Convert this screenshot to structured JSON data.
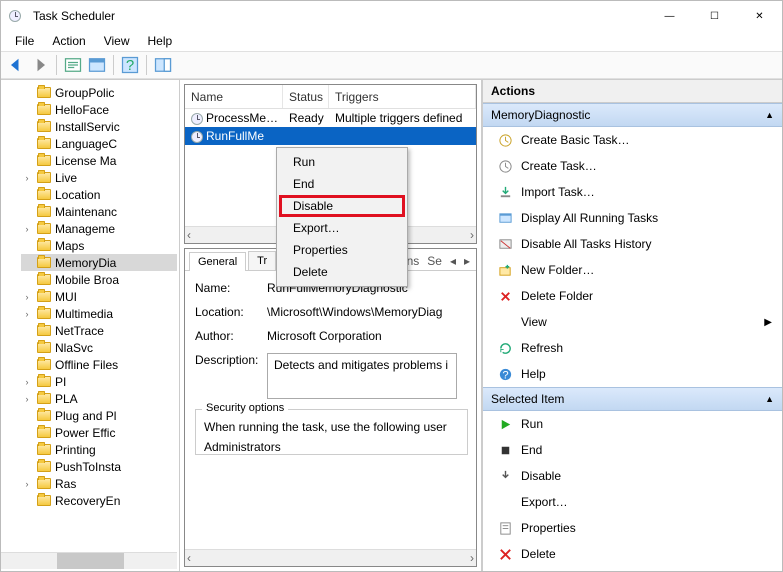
{
  "title": "Task Scheduler",
  "menus": [
    "File",
    "Action",
    "View",
    "Help"
  ],
  "tree": [
    {
      "label": "GroupPolic",
      "twisty": ""
    },
    {
      "label": "HelloFace",
      "twisty": ""
    },
    {
      "label": "InstallServic",
      "twisty": ""
    },
    {
      "label": "LanguageC",
      "twisty": ""
    },
    {
      "label": "License Ma",
      "twisty": ""
    },
    {
      "label": "Live",
      "twisty": "›"
    },
    {
      "label": "Location",
      "twisty": ""
    },
    {
      "label": "Maintenanc",
      "twisty": ""
    },
    {
      "label": "Manageme",
      "twisty": "›"
    },
    {
      "label": "Maps",
      "twisty": ""
    },
    {
      "label": "MemoryDia",
      "twisty": "",
      "selected": true
    },
    {
      "label": "Mobile Broa",
      "twisty": ""
    },
    {
      "label": "MUI",
      "twisty": "›"
    },
    {
      "label": "Multimedia",
      "twisty": "›"
    },
    {
      "label": "NetTrace",
      "twisty": ""
    },
    {
      "label": "NlaSvc",
      "twisty": ""
    },
    {
      "label": "Offline Files",
      "twisty": ""
    },
    {
      "label": "PI",
      "twisty": "›"
    },
    {
      "label": "PLA",
      "twisty": "›"
    },
    {
      "label": "Plug and Pl",
      "twisty": ""
    },
    {
      "label": "Power Effic",
      "twisty": ""
    },
    {
      "label": "Printing",
      "twisty": ""
    },
    {
      "label": "PushToInsta",
      "twisty": ""
    },
    {
      "label": "Ras",
      "twisty": "›"
    },
    {
      "label": "RecoveryEn",
      "twisty": ""
    }
  ],
  "task_columns": {
    "name": "Name",
    "status": "Status",
    "triggers": "Triggers"
  },
  "tasks": [
    {
      "name": "ProcessMe…",
      "status": "Ready",
      "triggers": "Multiple triggers defined"
    },
    {
      "name": "RunFullMe",
      "status": "",
      "triggers": "",
      "selected": true
    }
  ],
  "context_menu": [
    "Run",
    "End",
    "Disable",
    "Export…",
    "Properties",
    "Delete"
  ],
  "context_highlight_index": 2,
  "tabs": {
    "items": [
      "General",
      "Tr"
    ],
    "right": [
      "ns",
      "Se"
    ],
    "active": 0
  },
  "details": {
    "name_label": "Name:",
    "name_value": "RunFullMemoryDiagnostic",
    "location_label": "Location:",
    "location_value": "\\Microsoft\\Windows\\MemoryDiag",
    "author_label": "Author:",
    "author_value": "Microsoft Corporation",
    "description_label": "Description:",
    "description_value": "Detects and mitigates problems i",
    "security_legend": "Security options",
    "security_line1": "When running the task, use the following user",
    "security_line2": "Administrators"
  },
  "actions": {
    "header": "Actions",
    "section1": "MemoryDiagnostic",
    "items1": [
      {
        "icon": "wizard",
        "label": "Create Basic Task…"
      },
      {
        "icon": "create",
        "label": "Create Task…"
      },
      {
        "icon": "import",
        "label": "Import Task…"
      },
      {
        "icon": "display",
        "label": "Display All Running Tasks"
      },
      {
        "icon": "disable",
        "label": "Disable All Tasks History"
      },
      {
        "icon": "newfolder",
        "label": "New Folder…"
      },
      {
        "icon": "deletefolder",
        "label": "Delete Folder"
      },
      {
        "icon": "view",
        "label": "View",
        "arrow": true
      },
      {
        "icon": "refresh",
        "label": "Refresh"
      },
      {
        "icon": "help",
        "label": "Help"
      }
    ],
    "section2": "Selected Item",
    "items2": [
      {
        "icon": "run",
        "label": "Run"
      },
      {
        "icon": "end",
        "label": "End"
      },
      {
        "icon": "disable2",
        "label": "Disable"
      },
      {
        "icon": "export",
        "label": "Export…"
      },
      {
        "icon": "props",
        "label": "Properties"
      },
      {
        "icon": "delete",
        "label": "Delete"
      }
    ]
  }
}
